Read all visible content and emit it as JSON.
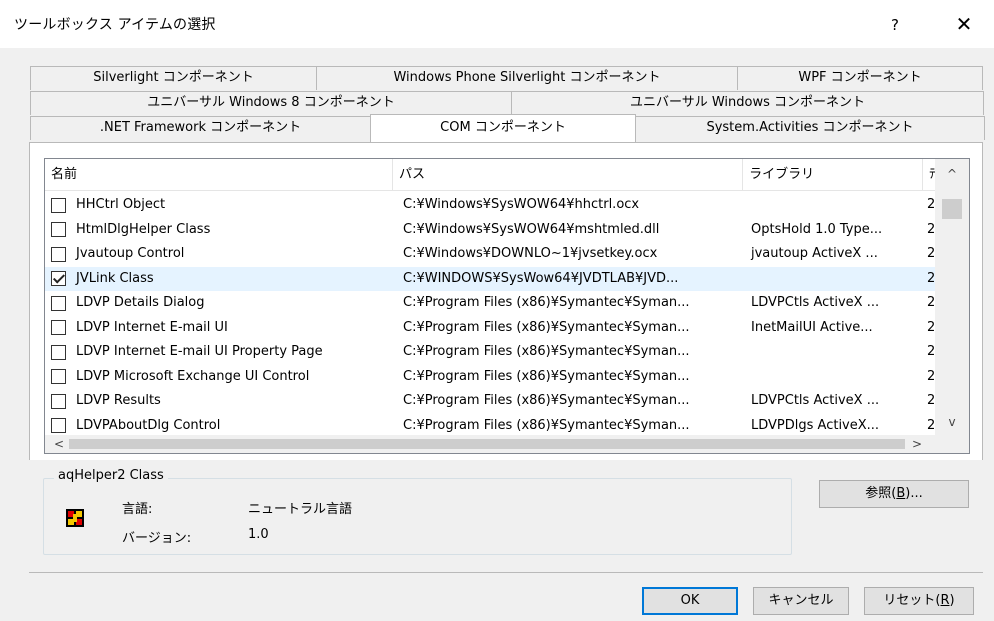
{
  "dialog": {
    "title": "ツールボックス アイテムの選択",
    "help_label": "?",
    "close_label": "✕"
  },
  "tabs": {
    "row1": [
      "Silverlight コンポーネント",
      "Windows Phone Silverlight コンポーネント",
      "WPF コンポーネント"
    ],
    "row2": [
      "ユニバーサル Windows 8 コンポーネント",
      "ユニバーサル Windows コンポーネント"
    ],
    "row3": [
      ".NET Framework コンポーネント",
      "COM コンポーネント",
      "System.Activities コンポーネント"
    ],
    "selected": "COM コンポーネント"
  },
  "list": {
    "columns": [
      "名前",
      "パス",
      "ライブラリ",
      "ﾃ"
    ],
    "rows": [
      {
        "checked": false,
        "name": "HHCtrl Object",
        "path": "C:¥Windows¥SysWOW64¥hhctrl.ocx",
        "library": "",
        "version": "2"
      },
      {
        "checked": false,
        "name": "HtmlDlgHelper Class",
        "path": "C:¥Windows¥SysWOW64¥mshtmled.dll",
        "library": "OptsHold 1.0 Type...",
        "version": "2"
      },
      {
        "checked": false,
        "name": "Jvautoup Control",
        "path": "C:¥Windows¥DOWNLO~1¥jvsetkey.ocx",
        "library": "jvautoup ActiveX ...",
        "version": "2"
      },
      {
        "checked": true,
        "name": "JVLink Class",
        "path": "C:¥WINDOWS¥SysWow64¥JVDTLAB¥JVD...",
        "library": "",
        "version": "2"
      },
      {
        "checked": false,
        "name": "LDVP Details Dialog",
        "path": "C:¥Program Files (x86)¥Symantec¥Syman...",
        "library": "LDVPCtls ActiveX ...",
        "version": "2"
      },
      {
        "checked": false,
        "name": "LDVP Internet E-mail UI",
        "path": "C:¥Program Files (x86)¥Symantec¥Syman...",
        "library": "InetMailUI Active...",
        "version": "2"
      },
      {
        "checked": false,
        "name": "LDVP Internet E-mail UI Property Page",
        "path": "C:¥Program Files (x86)¥Symantec¥Syman...",
        "library": "",
        "version": "2"
      },
      {
        "checked": false,
        "name": "LDVP Microsoft Exchange UI Control",
        "path": "C:¥Program Files (x86)¥Symantec¥Syman...",
        "library": "",
        "version": "2"
      },
      {
        "checked": false,
        "name": "LDVP Results",
        "path": "C:¥Program Files (x86)¥Symantec¥Syman...",
        "library": "LDVPCtls ActiveX ...",
        "version": "2"
      },
      {
        "checked": false,
        "name": "LDVPAboutDlg Control",
        "path": "C:¥Program Files (x86)¥Symantec¥Syman...",
        "library": "LDVPDlgs ActiveX...",
        "version": "2"
      }
    ],
    "scroll_up": "^",
    "scroll_down": "v",
    "scroll_left": "<",
    "scroll_right": ">"
  },
  "details": {
    "group_title": "aqHelper2 Class",
    "language_label": "言語:",
    "language_value": "ニュートラル言語",
    "version_label": "バージョン:",
    "version_value": "1.0"
  },
  "buttons": {
    "browse_prefix": "参照(",
    "browse_key": "B",
    "browse_suffix": ")...",
    "ok": "OK",
    "cancel": "キャンセル",
    "reset_prefix": "リセット(",
    "reset_key": "R",
    "reset_suffix": ")"
  },
  "colors": {
    "dialog_bg": "#f0f0f0",
    "highlight_row": "#e5f3ff",
    "default_button_border": "#0078d7"
  }
}
